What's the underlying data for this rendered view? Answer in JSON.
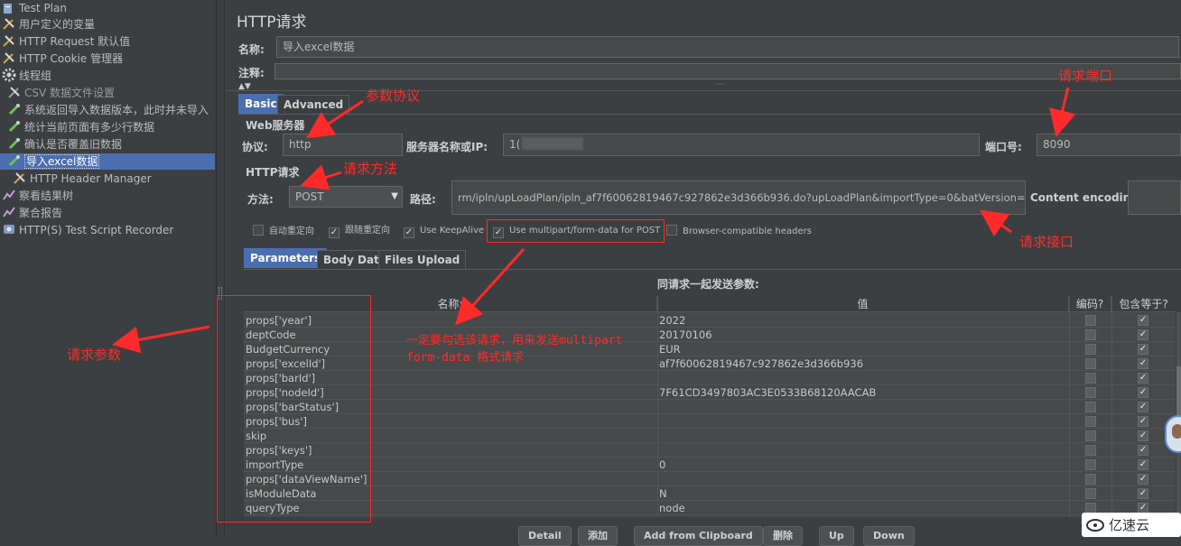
{
  "tree": {
    "items": [
      {
        "label": "Test Plan",
        "icon": "test-plan-icon"
      },
      {
        "label": "用户定义的变量",
        "icon": "wrench-icon"
      },
      {
        "label": "HTTP Request 默认值",
        "icon": "wrench-icon"
      },
      {
        "label": "HTTP Cookie 管理器",
        "icon": "wrench-icon"
      },
      {
        "label": "线程组",
        "icon": "gear-icon"
      },
      {
        "label": "CSV 数据文件设置",
        "icon": "wrench-icon"
      },
      {
        "label": "系统返回导入数据版本，此时并未导入",
        "icon": "pipette-icon"
      },
      {
        "label": "统计当前页面有多少行数据",
        "icon": "pipette-icon"
      },
      {
        "label": "确认是否覆盖旧数据",
        "icon": "pipette-icon"
      },
      {
        "label": "导入excel数据",
        "icon": "pipette-icon"
      },
      {
        "label": "HTTP Header Manager",
        "icon": "wrench-icon"
      },
      {
        "label": "察看结果树",
        "icon": "chart-icon"
      },
      {
        "label": "聚合报告",
        "icon": "chart-icon"
      },
      {
        "label": "HTTP(S) Test Script Recorder",
        "icon": "recorder-icon"
      }
    ]
  },
  "panel": {
    "title": "HTTP请求",
    "name_label": "名称:",
    "name_value": "导入excel数据",
    "comment_label": "注释:",
    "comment_value": "",
    "tabs": [
      "Basic",
      "Advanced"
    ],
    "web_server_title": "Web服务器",
    "protocol_label": "协议:",
    "protocol_value": "http",
    "server_label": "服务器名称或IP:",
    "server_value": "1(",
    "port_label": "端口号:",
    "port_value": "8090",
    "http_request_title": "HTTP请求",
    "method_label": "方法:",
    "method_value": "POST",
    "path_label": "路径:",
    "path_value": "rm/ipln/upLoadPlan/ipln_af7f60062819467c927862e3d366b936.do?upLoadPlan&importType=0&batVersion=null",
    "encoding_label": "Content encoding:",
    "encoding_value": "",
    "options": [
      {
        "label": "自动重定向",
        "checked": false
      },
      {
        "label": "跟随重定向",
        "checked": true
      },
      {
        "label": "Use KeepAlive",
        "checked": true
      },
      {
        "label": "Use multipart/form-data for POST",
        "checked": true
      },
      {
        "label": "Browser-compatible headers",
        "checked": false
      }
    ],
    "sub_tabs": [
      "Parameters",
      "Body Data",
      "Files Upload"
    ],
    "params_caption": "同请求一起发送参数:",
    "columns": [
      "名称:",
      "值",
      "编码?",
      "包含等于?"
    ],
    "rows": [
      {
        "name": "props['year']",
        "value": "2022",
        "encode": false,
        "include_equals": true
      },
      {
        "name": "deptCode",
        "value": "20170106",
        "encode": false,
        "include_equals": true
      },
      {
        "name": "BudgetCurrency",
        "value": "EUR",
        "encode": false,
        "include_equals": true
      },
      {
        "name": "props['excelId']",
        "value": "af7f60062819467c927862e3d366b936",
        "encode": false,
        "include_equals": true
      },
      {
        "name": "props['barId']",
        "value": "",
        "encode": false,
        "include_equals": true
      },
      {
        "name": "props['nodeId']",
        "value": "7F61CD3497803AC3E0533B68120AACAB",
        "encode": false,
        "include_equals": true
      },
      {
        "name": "props['barStatus']",
        "value": "",
        "encode": false,
        "include_equals": true
      },
      {
        "name": "props['bus']",
        "value": "",
        "encode": false,
        "include_equals": true
      },
      {
        "name": "skip",
        "value": "",
        "encode": false,
        "include_equals": true
      },
      {
        "name": "props['keys']",
        "value": "",
        "encode": false,
        "include_equals": true
      },
      {
        "name": "importType",
        "value": "0",
        "encode": false,
        "include_equals": true
      },
      {
        "name": "props['dataViewName']",
        "value": "",
        "encode": false,
        "include_equals": true
      },
      {
        "name": "isModuleData",
        "value": "N",
        "encode": false,
        "include_equals": true
      },
      {
        "name": "queryType",
        "value": "node",
        "encode": false,
        "include_equals": true
      }
    ],
    "buttons": [
      "Detail",
      "添加",
      "Add from Clipboard",
      "删除",
      "Up",
      "Down"
    ]
  },
  "annotations": {
    "protocol": "参数协议",
    "port": "请求端口",
    "method": "请求方法",
    "path": "请求接口",
    "params": "请求参数",
    "multipart_line1": "一定要勾选该请求，用来发送multipart",
    "multipart_line2": "form-data 格式请求",
    "color": "#ff2a2a"
  },
  "watermark": {
    "text": "亿速云"
  }
}
